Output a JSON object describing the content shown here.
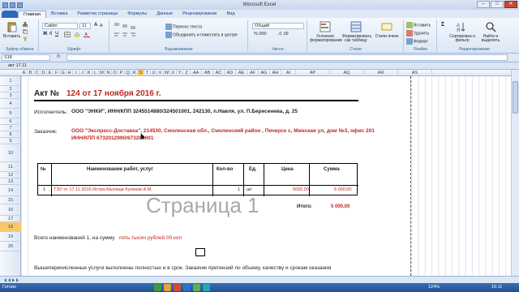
{
  "window": {
    "title": "Microsoft Excel",
    "minimize": "–",
    "maximize": "□",
    "close": "✕"
  },
  "ribbon_tabs": [
    "Главная",
    "Вставка",
    "Разметка страницы",
    "Формулы",
    "Данные",
    "Рецензирование",
    "Вид"
  ],
  "ribbon": {
    "clipboard": {
      "paste": "Вставить",
      "label": "Буфер обмена"
    },
    "font": {
      "name": "Calibri",
      "size": "11",
      "label": "Шрифт"
    },
    "alignment": {
      "wrap": "Перенос текста",
      "merge": "Объединить и поместить в центре",
      "label": "Выравнивание"
    },
    "number": {
      "format": "Общий",
      "label": "Число"
    },
    "styles": {
      "cond": "Условное форматирование",
      "table": "Форматировать как таблицу",
      "cell": "Стили ячеек",
      "label": "Стили"
    },
    "cells": {
      "insert": "Вставить",
      "delete": "Удалить",
      "format": "Формат",
      "label": "Ячейки"
    },
    "editing": {
      "sort": "Сортировка и фильтр",
      "find": "Найти и выделить",
      "label": "Редактирование"
    }
  },
  "formula_bar": {
    "name_box": "S18",
    "fx": "fx",
    "value": ""
  },
  "workbook_title": "акт 17.11",
  "columns": [
    "A",
    "B",
    "C",
    "D",
    "E",
    "F",
    "G",
    "H",
    "I",
    "J",
    "K",
    "L",
    "M",
    "N",
    "O",
    "P",
    "Q",
    "R",
    "S",
    "T",
    "U",
    "V",
    "W",
    "X",
    "Y",
    "Z",
    "AA",
    "AB",
    "AC",
    "AD",
    "AE",
    "AF",
    "AG",
    "AH",
    "AI",
    "AP",
    "AQ",
    "AR",
    "AS"
  ],
  "selected_column": "S",
  "rows": [
    "1",
    "2",
    "3",
    "4",
    "5",
    "6",
    "7",
    "8",
    "9",
    "10",
    "11",
    "12",
    "13",
    "14",
    "15",
    "16",
    "17",
    "18",
    "19",
    "20"
  ],
  "selected_row": "18",
  "act": {
    "title_prefix": "Акт №",
    "title_number": "124 от 17 ноября 2016 г.",
    "executor_label": "Исполнитель:",
    "executor_value": "ООО \"ЭНКИ\", ИНН/КПП 3245514880/324501001, 242130, п.Навля, ул. П.Бересенева, д. 25",
    "customer_label": "Заказчик:",
    "customer_value_1": "ООО \"Экспресс-Доставка\", 214530, Смоленская обл., Смоленский район , Печерск с, Минская ул, дом №3, офис 201",
    "customer_value_2": "ИНН/КПП 6732012990/673201001"
  },
  "table": {
    "headers": [
      "№",
      "Наименование работ, услуг",
      "Кол-во",
      "Ед.",
      "Цена",
      "Сумма"
    ],
    "row": {
      "num": "1",
      "name": "ТЭУ от 17.11.2016 Истра-Мытищи  Куликов А.М.",
      "qty": "1",
      "unit": "шт",
      "price": "5000,00",
      "sum": "5 000,00"
    },
    "total_label": "Итого:",
    "total_value": "5 000,00"
  },
  "summary": {
    "text": "Всего наименований 1, на сумму ",
    "amount_words": "пять тысяч рублей 00 коп"
  },
  "footer_note": "Вышеперечисленные услуги выполнены полностью и в срок. Заказчик претензий по объему, качеству и срокам оказания",
  "watermark": "Страница 1",
  "status": {
    "ready": "Готово",
    "zoom": "124%",
    "clock": "16:11"
  }
}
